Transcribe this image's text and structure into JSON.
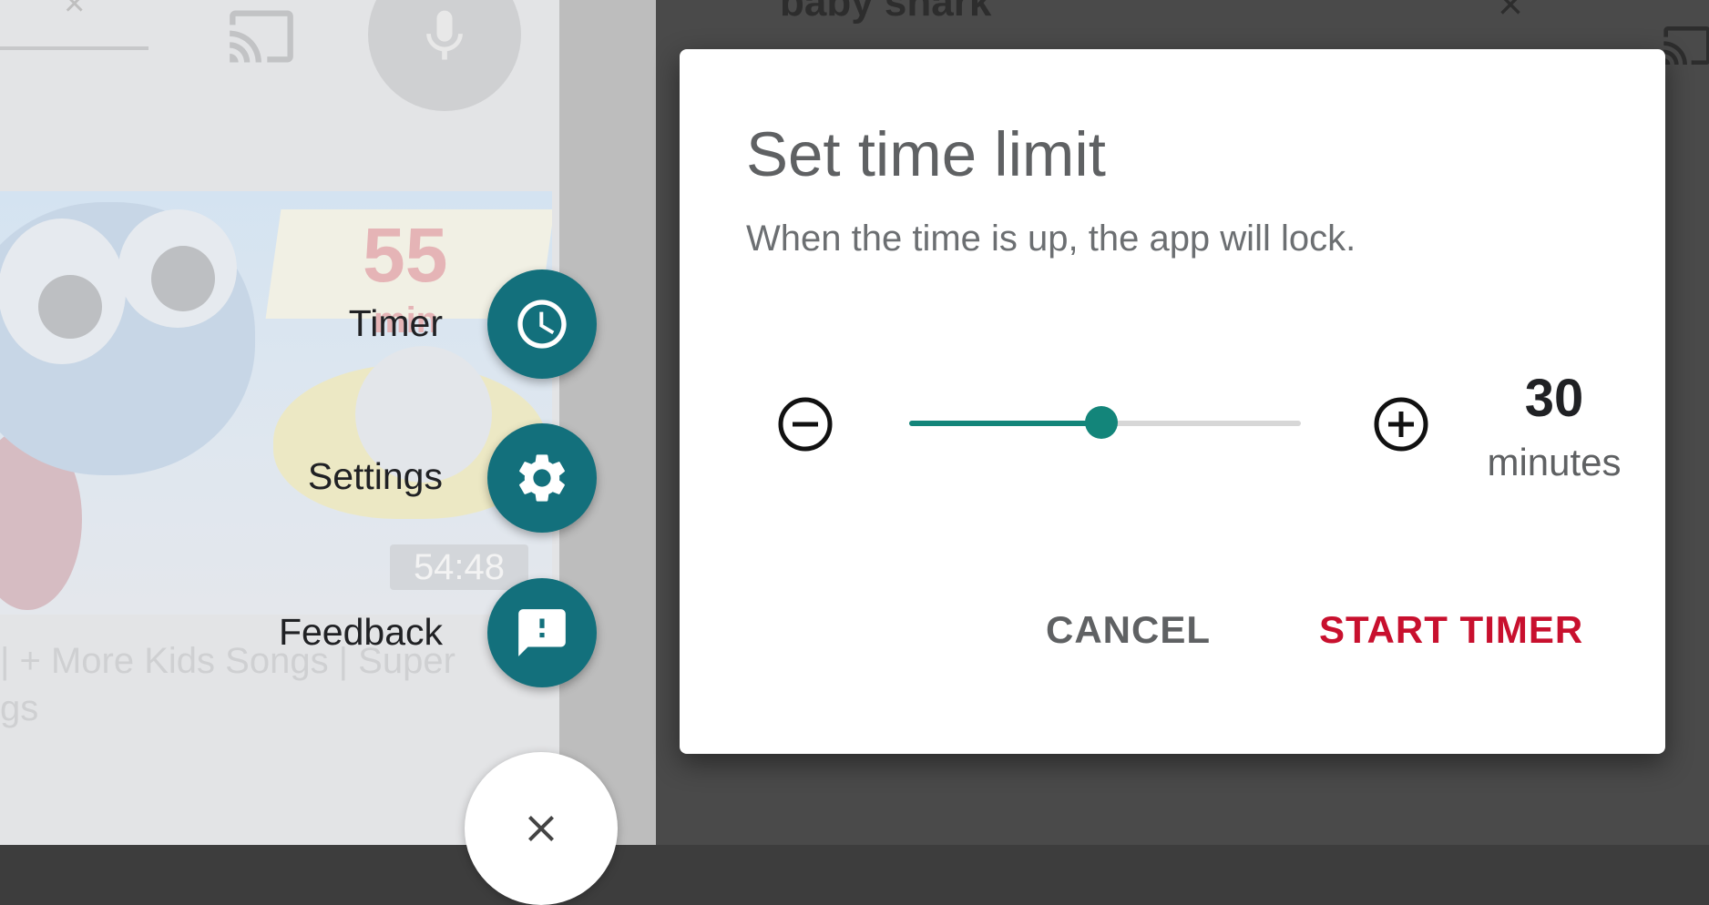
{
  "background": {
    "search_query": "baby shark",
    "video": {
      "duration": "54:48",
      "thumbnail_badge_number": "55",
      "thumbnail_badge_unit": "min",
      "title_line1": "| + More Kids Songs | Super",
      "title_line2": "gs"
    }
  },
  "speed_dial": {
    "items": [
      {
        "label": "Timer",
        "icon": "clock-icon"
      },
      {
        "label": "Settings",
        "icon": "gear-icon"
      },
      {
        "label": "Feedback",
        "icon": "feedback-icon"
      }
    ],
    "close_icon": "close-icon"
  },
  "dialog": {
    "title": "Set time limit",
    "message": "When the time is up, the app will lock.",
    "slider": {
      "value": 30,
      "min": 0,
      "max": 60,
      "fraction": 0.49
    },
    "time_value": "30",
    "time_unit": "minutes",
    "cancel_label": "CANCEL",
    "start_label": "START TIMER"
  },
  "colors": {
    "fab": "#13707c",
    "slider_accent": "#13857a",
    "start_button": "#c8102e"
  }
}
